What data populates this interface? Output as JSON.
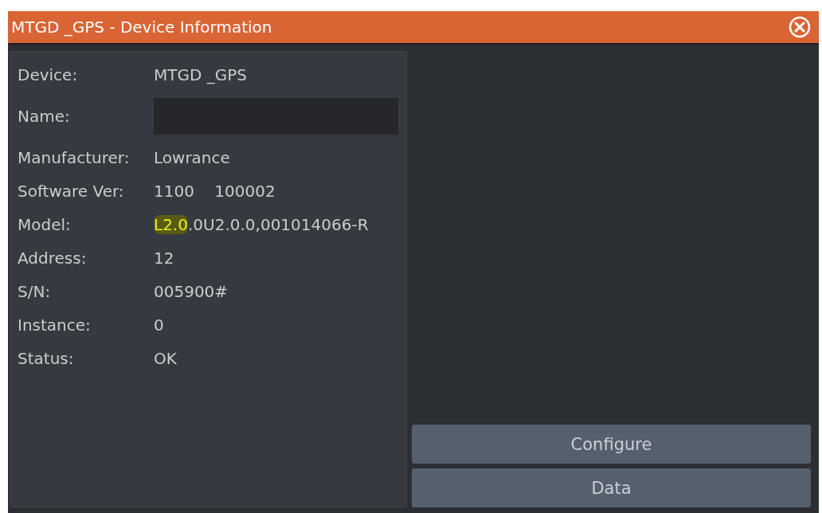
{
  "window": {
    "title": "MTGD _GPS - Device Information"
  },
  "fields": [
    {
      "label": "Device:",
      "kind": "text",
      "value": "MTGD _GPS"
    },
    {
      "label": "Name:",
      "kind": "input"
    },
    {
      "label": "Manufacturer:",
      "kind": "text",
      "value": "Lowrance"
    },
    {
      "label": "Software Ver:",
      "kind": "text",
      "value": "1100    100002"
    },
    {
      "label": "Model:",
      "kind": "parts",
      "parts": [
        {
          "text": "L2.0",
          "highlighted": true
        },
        {
          "text": ".0U2.0.0,001014066-R",
          "highlighted": false
        }
      ]
    },
    {
      "label": "Address:",
      "kind": "text",
      "value": "12"
    },
    {
      "label": "S/N:",
      "kind": "text",
      "value": "005900#"
    },
    {
      "label": "Instance:",
      "kind": "text",
      "value": "0"
    },
    {
      "label": "Status:",
      "kind": "text",
      "value": "OK"
    }
  ],
  "buttons": [
    "Configure",
    "Data"
  ]
}
